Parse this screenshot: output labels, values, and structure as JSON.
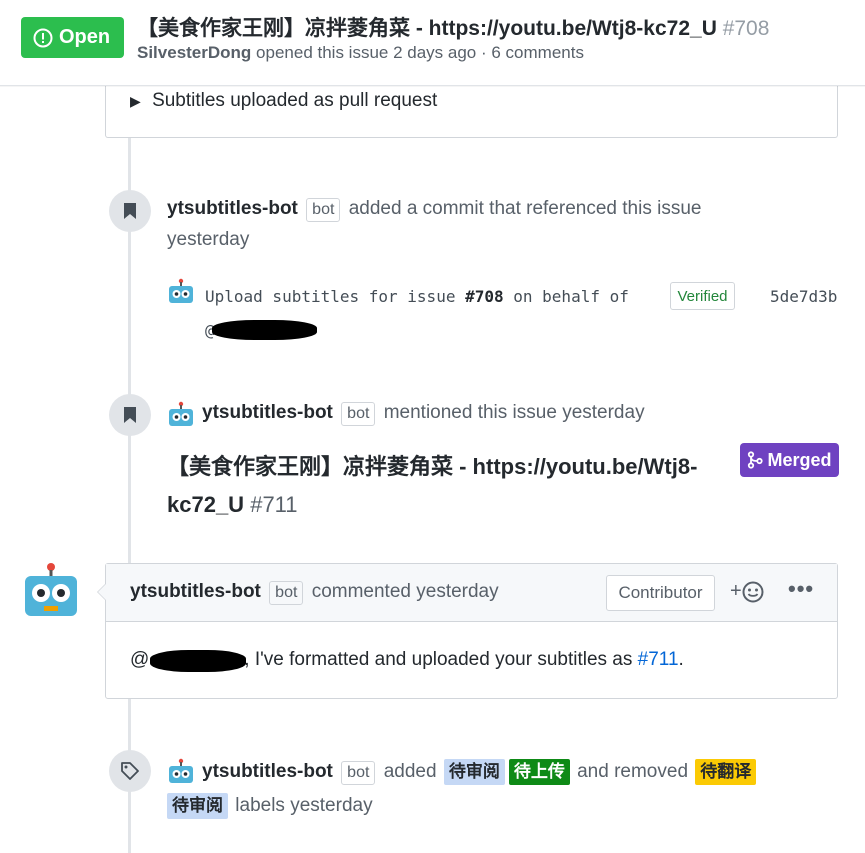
{
  "header": {
    "state_label": "Open",
    "title": "【美食作家王刚】凉拌菱角菜 - https://youtu.be/Wtj8-kc72_U",
    "number": "#708",
    "author": "SilvesterDong",
    "meta_rest": "opened this issue 2 days ago · 6 comments"
  },
  "top_card": {
    "summary": "Subtitles uploaded as pull request"
  },
  "events": {
    "commit": {
      "actor": "ytsubtitles-bot",
      "bot_tag": "bot",
      "action": "added a commit that referenced this issue",
      "when": "yesterday",
      "message_pre": "Upload subtitles for issue",
      "issue_ref": "#708",
      "message_post": "on behalf of",
      "mention_at": "@",
      "verified": "Verified",
      "sha": "5de7d3b"
    },
    "mention": {
      "actor": "ytsubtitles-bot",
      "bot_tag": "bot",
      "action": "mentioned this issue yesterday",
      "ref_title": "【美食作家王刚】凉拌菱角菜 - https://youtu.be/Wtj8-kc72_U",
      "ref_number": "#711",
      "status": "Merged"
    },
    "comment": {
      "actor": "ytsubtitles-bot",
      "bot_tag": "bot",
      "action": "commented yesterday",
      "role": "Contributor",
      "body_at": "@",
      "body_text": ", I've formatted and uploaded your subtitles as",
      "body_link": "#711",
      "body_end": "."
    },
    "labels": {
      "actor": "ytsubtitles-bot",
      "bot_tag": "bot",
      "added_word": "added",
      "added": [
        {
          "name": "待审阅",
          "bg": "#c5d8f5",
          "fg": "#24292e"
        },
        {
          "name": "待上传",
          "bg": "#0e8a16",
          "fg": "#ffffff"
        }
      ],
      "removed_word": "and removed",
      "removed": [
        {
          "name": "待翻译",
          "bg": "#fbca04",
          "fg": "#24292e"
        },
        {
          "name": "待审阅",
          "bg": "#c5d8f5",
          "fg": "#24292e"
        }
      ],
      "tail": "labels yesterday"
    }
  },
  "colors": {
    "open": "#2cbe4e",
    "merged": "#6f42c1",
    "link": "#0366d6"
  }
}
